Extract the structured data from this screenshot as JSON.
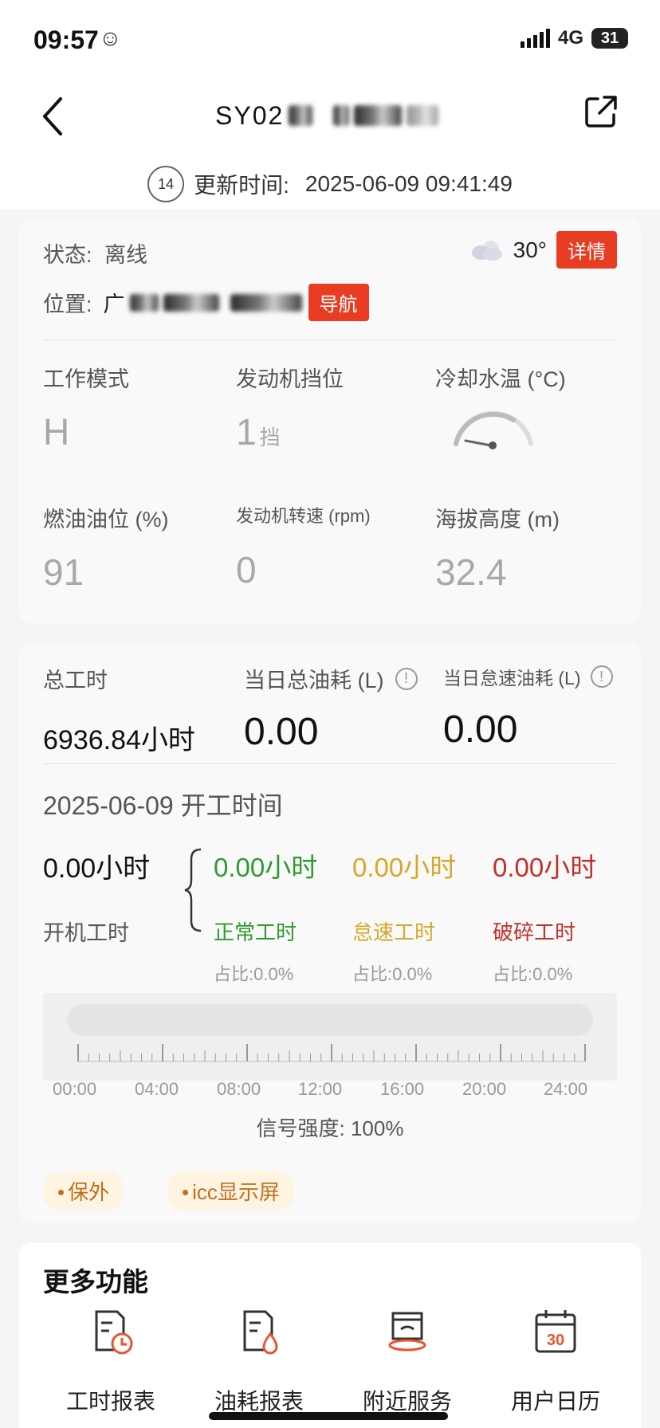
{
  "status_bar": {
    "time": "09:57",
    "network": "4G",
    "battery": "31"
  },
  "header": {
    "title": "SY02",
    "icons": [
      "back-arrow-icon",
      "share-icon"
    ]
  },
  "update": {
    "badge": "14",
    "label": "更新时间:",
    "value": "2025-06-09 09:41:49"
  },
  "overview": {
    "status_label": "状态:",
    "status_value": "离线",
    "weather_temp": "30°",
    "detail_button": "详情",
    "location_label": "位置:",
    "location_value": "广",
    "nav_button": "导航",
    "metrics": [
      {
        "label": "工作模式",
        "value": "H"
      },
      {
        "label": "发动机挡位",
        "value": "1",
        "unit": "挡"
      },
      {
        "label": "冷却水温 (°C)"
      },
      {
        "label": "燃油油位 (%)",
        "value": "91"
      },
      {
        "label": "发动机转速 (rpm)",
        "value": "0"
      },
      {
        "label": "海拔高度 (m)",
        "value": "32.4"
      }
    ]
  },
  "work": {
    "total_hours_label": "总工时",
    "total_hours_value": "6936.84小时",
    "fuel_total_label": "当日总油耗 (L)",
    "fuel_total_value": "0.00",
    "fuel_idle_label": "当日怠速油耗 (L)",
    "fuel_idle_value": "0.00",
    "date_title": "2025-06-09 开工时间",
    "run_value": "0.00小时",
    "run_label": "开机工时",
    "breakdown": [
      {
        "value": "0.00小时",
        "label": "正常工时",
        "ratio": "占比:0.0%",
        "color": "#2e9a2e"
      },
      {
        "value": "0.00小时",
        "label": "怠速工时",
        "ratio": "占比:0.0%",
        "color": "#d4a82a"
      },
      {
        "value": "0.00小时",
        "label": "破碎工时",
        "ratio": "占比:0.0%",
        "color": "#c0302a"
      }
    ],
    "timeline_labels": [
      "00:00",
      "04:00",
      "08:00",
      "12:00",
      "16:00",
      "20:00",
      "24:00"
    ],
    "signal": "信号强度: 100%",
    "tags": [
      "保外",
      "icc显示屏"
    ]
  },
  "more": {
    "title": "更多功能",
    "items": [
      {
        "label": "工时报表",
        "icon": "work-hours-report-icon"
      },
      {
        "label": "油耗报表",
        "icon": "fuel-report-icon"
      },
      {
        "label": "附近服务",
        "icon": "nearby-service-icon"
      },
      {
        "label": "用户日历",
        "icon": "calendar-icon",
        "day": "30"
      }
    ]
  }
}
